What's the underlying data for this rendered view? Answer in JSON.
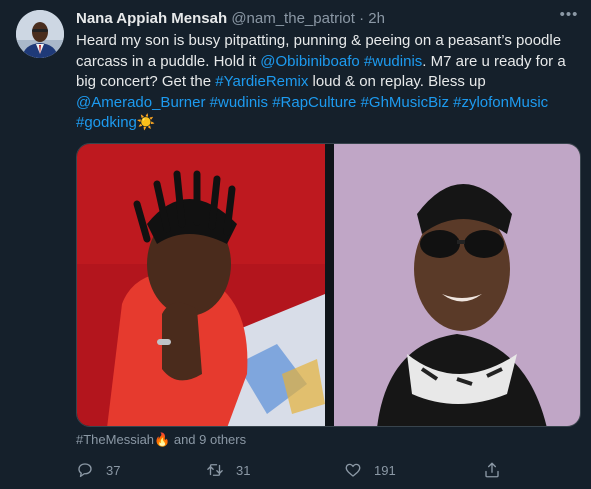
{
  "tweet": {
    "author_name": "Nana Appiah Mensah",
    "handle": "@nam_the_patriot",
    "separator": "·",
    "time": "2h",
    "lines": [
      {
        "segments": [
          {
            "text": "Heard my son is busy pitpatting, punning & peeing on a peasant’s poodle",
            "link": false
          }
        ]
      },
      {
        "segments": [
          {
            "text": "carcass in a puddle. Hold it ",
            "link": false
          },
          {
            "text": "@Obibiniboafo",
            "link": true
          },
          {
            "text": " ",
            "link": false
          },
          {
            "text": "#wudinis",
            "link": true
          },
          {
            "text": ". M7 are u ready for a",
            "link": false
          }
        ]
      },
      {
        "segments": [
          {
            "text": "big concert? Get the ",
            "link": false
          },
          {
            "text": "#YardieRemix",
            "link": true
          },
          {
            "text": " loud & on replay. Bless up",
            "link": false
          }
        ]
      },
      {
        "segments": [
          {
            "text": "@Amerado_Burner",
            "link": true
          },
          {
            "text": " ",
            "link": false
          },
          {
            "text": "#wudinis",
            "link": true
          },
          {
            "text": " ",
            "link": false
          },
          {
            "text": "#RapCulture",
            "link": true
          },
          {
            "text": " ",
            "link": false
          },
          {
            "text": "#GhMusicBiz",
            "link": true
          },
          {
            "text": " ",
            "link": false
          },
          {
            "text": "#zylofonMusic",
            "link": true
          }
        ]
      },
      {
        "segments": [
          {
            "text": "#godking",
            "link": true
          },
          {
            "text": "☀️",
            "link": false
          }
        ]
      }
    ],
    "tags": {
      "hashtag": "#TheMessiah",
      "emoji": "🔥",
      "others": " and 9 others"
    },
    "actions": {
      "reply_count": "37",
      "retweet_count": "31",
      "like_count": "191"
    }
  },
  "colors": {
    "background": "#15202b",
    "text": "#e7e9ea",
    "muted": "#8b98a5",
    "link": "#1d9bf0"
  },
  "icons": [
    "more-icon",
    "reply-icon",
    "retweet-icon",
    "like-icon",
    "share-icon"
  ]
}
